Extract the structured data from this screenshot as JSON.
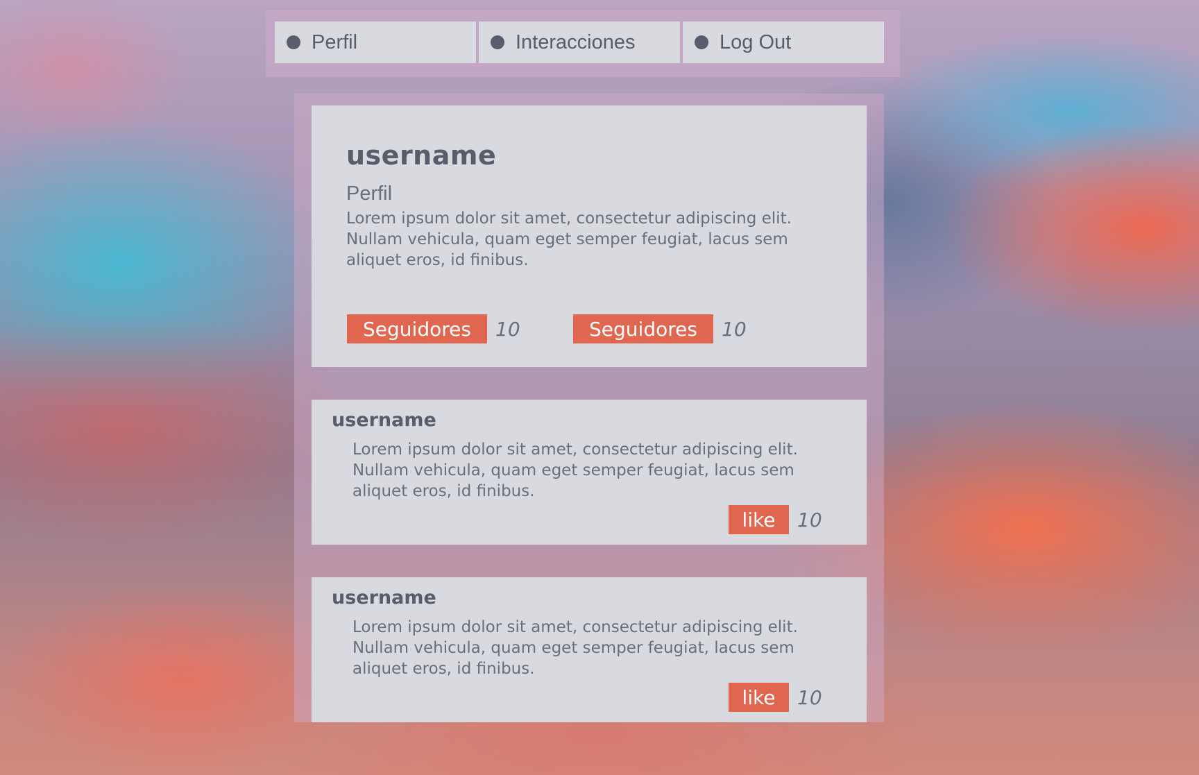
{
  "nav": {
    "items": [
      {
        "label": "Perfil",
        "icon": "dot-icon"
      },
      {
        "label": "Interacciones",
        "icon": "dot-icon"
      },
      {
        "label": "Log Out",
        "icon": "dot-icon"
      }
    ]
  },
  "profile": {
    "username": "username",
    "subtitle": "Perfil",
    "bio": "Lorem ipsum dolor sit amet, consectetur adipiscing elit. Nullam vehicula, quam eget semper feugiat, lacus sem aliquet eros, id finibus.",
    "stats": [
      {
        "label": "Seguidores",
        "count": "10"
      },
      {
        "label": "Seguidores",
        "count": "10"
      }
    ]
  },
  "posts": [
    {
      "username": "username",
      "text": "Lorem ipsum dolor sit amet, consectetur adipiscing elit. Nullam vehicula, quam eget semper feugiat, lacus sem aliquet eros, id finibus.",
      "like_label": "like",
      "like_count": "10"
    },
    {
      "username": "username",
      "text": "Lorem ipsum dolor sit amet, consectetur adipiscing elit. Nullam vehicula, quam eget semper feugiat, lacus sem aliquet eros, id finibus.",
      "like_label": "like",
      "like_count": "10"
    }
  ],
  "colors": {
    "accent": "#e06650",
    "card": "#d8dae0",
    "text": "#595c6a"
  }
}
